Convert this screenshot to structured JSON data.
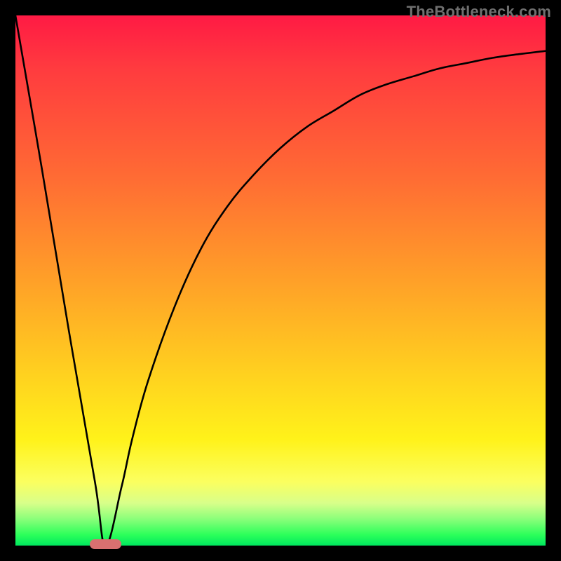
{
  "watermark": "TheBottleneck.com",
  "colors": {
    "black": "#000000",
    "curve": "#000000",
    "marker": "#d87070",
    "watermark": "#6f6f6f"
  },
  "chart_data": {
    "type": "line",
    "title": "",
    "xlabel": "",
    "ylabel": "",
    "xlim": [
      0,
      100
    ],
    "ylim": [
      0,
      100
    ],
    "grid": false,
    "legend": false,
    "background_gradient": [
      "#ff1a44",
      "#ffa028",
      "#fff21a",
      "#00e85e"
    ],
    "description": "V-shaped bottleneck curve: steep linear descent on the left down to a minimum near x≈17, then a concave rise (diminishing returns) toward the top-right. Values are in percentage (0–100) of the vertical axis, estimated from pixels; higher y = higher bottleneck (red), y≈0 = no bottleneck (green).",
    "series": [
      {
        "name": "bottleneck-curve",
        "x": [
          0,
          5,
          10,
          15,
          17,
          20,
          22,
          25,
          30,
          35,
          40,
          45,
          50,
          55,
          60,
          65,
          70,
          75,
          80,
          85,
          90,
          95,
          100
        ],
        "y": [
          100,
          71,
          41,
          12,
          0,
          11,
          20,
          31,
          45,
          56,
          64,
          70,
          75,
          79,
          82,
          85,
          87,
          88.5,
          90,
          91,
          92,
          92.7,
          93.3
        ]
      }
    ],
    "marker": {
      "name": "optimal-range",
      "x_center": 17,
      "x_halfwidth": 3,
      "y": 0,
      "note": "green band at bottom where bottleneck ≈ 0"
    }
  }
}
